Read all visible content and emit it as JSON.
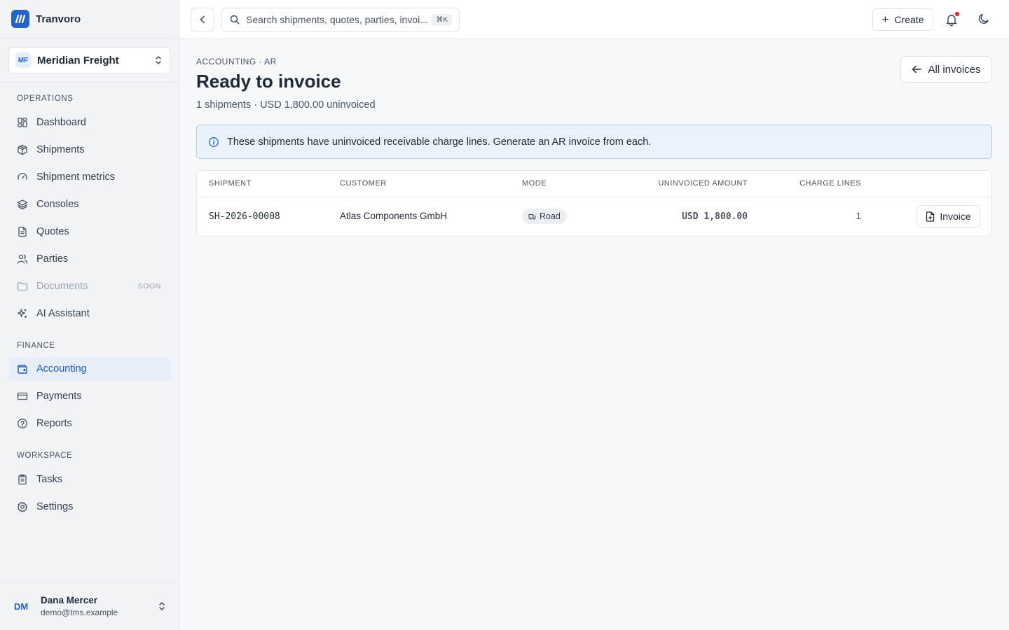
{
  "app": {
    "name": "Tranvoro"
  },
  "org": {
    "initials": "MF",
    "name": "Meridian Freight"
  },
  "sidebar": {
    "operations_label": "OPERATIONS",
    "finance_label": "FINANCE",
    "workspace_label": "WORKSPACE",
    "operations": [
      {
        "label": "Dashboard",
        "icon": "dashboard-icon"
      },
      {
        "label": "Shipments",
        "icon": "package-icon"
      },
      {
        "label": "Shipment metrics",
        "icon": "gauge-icon"
      },
      {
        "label": "Consoles",
        "icon": "layers-icon"
      },
      {
        "label": "Quotes",
        "icon": "file-text-icon"
      },
      {
        "label": "Parties",
        "icon": "users-icon"
      },
      {
        "label": "Documents",
        "icon": "folder-icon",
        "badge": "SOON"
      },
      {
        "label": "AI Assistant",
        "icon": "sparkles-icon"
      }
    ],
    "finance": [
      {
        "label": "Accounting",
        "icon": "wallet-icon",
        "active": true
      },
      {
        "label": "Payments",
        "icon": "credit-card-icon"
      },
      {
        "label": "Reports",
        "icon": "help-circle-icon"
      }
    ],
    "workspace": [
      {
        "label": "Tasks",
        "icon": "clipboard-icon"
      },
      {
        "label": "Settings",
        "icon": "gear-icon"
      }
    ]
  },
  "user": {
    "initials": "DM",
    "name": "Dana Mercer",
    "email": "demo@tms.example"
  },
  "topbar": {
    "search_placeholder": "Search shipments, quotes, parties, invoi...",
    "search_shortcut": "⌘K",
    "create_label": "Create"
  },
  "page": {
    "eyebrow": "ACCOUNTING · AR",
    "title": "Ready to invoice",
    "subtitle": "1 shipments · USD 1,800.00 uninvoiced",
    "all_invoices_label": "All invoices",
    "info": "These shipments have uninvoiced receivable charge lines. Generate an AR invoice from each."
  },
  "table": {
    "columns": [
      "SHIPMENT",
      "CUSTOMER",
      "MODE",
      "UNINVOICED AMOUNT",
      "CHARGE LINES"
    ],
    "rows": [
      {
        "shipment": "SH-2026-00008",
        "customer": "Atlas Components GmbH",
        "mode": "Road",
        "amount": "USD 1,800.00",
        "charge_lines": "1",
        "action": "Invoice"
      }
    ]
  },
  "colors": {
    "accent": "#2563c9",
    "active_bg": "#e8eef7",
    "info_bg": "#e9f1fc",
    "notification": "#dc2626"
  }
}
